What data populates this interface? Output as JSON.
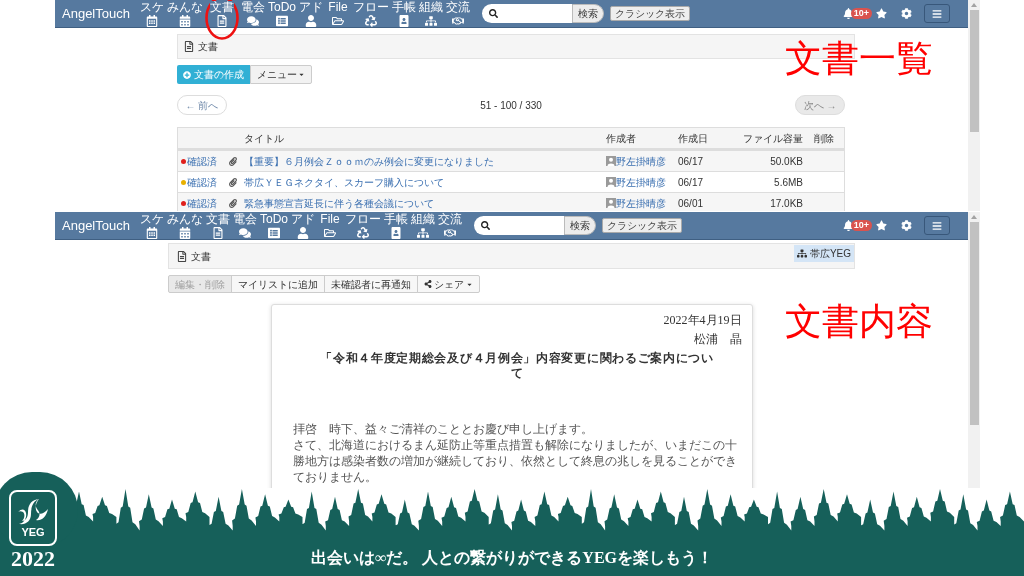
{
  "screenshots": [
    {
      "kind": "document_list",
      "annotation": "文書一覧",
      "navbar": {
        "brand": "AngelTouch",
        "items": [
          {
            "label": "スケ",
            "circled": false
          },
          {
            "label": "みんな",
            "circled": false
          },
          {
            "label": "文書",
            "circled": true
          },
          {
            "label": "電会",
            "circled": false
          },
          {
            "label": "ToDo",
            "circled": false
          },
          {
            "label": "アド",
            "circled": false
          },
          {
            "label": "File",
            "circled": false
          },
          {
            "label": "フロー",
            "circled": false
          },
          {
            "label": "手帳",
            "circled": false
          },
          {
            "label": "組織",
            "circled": false
          },
          {
            "label": "交流",
            "circled": false
          }
        ],
        "search_button": "検索",
        "classic_button": "クラシック表示",
        "notification_count": "10+"
      },
      "header": {
        "title": "文書"
      },
      "actions": {
        "create_button": "文書の作成",
        "menu_button": "メニュー"
      },
      "pager": {
        "previous": "← 前へ",
        "range": "51 - 100 / 330",
        "next": "次へ →"
      },
      "table": {
        "columns": [
          "タイトル",
          "作成者",
          "作成日",
          "ファイル容量",
          "削除"
        ],
        "rows": [
          {
            "status": "確認済",
            "color": "#e0201c",
            "title": "【重要】６月例会Ｚｏｏｍのみ例会に変更になりました",
            "author": "野左掛晴彦",
            "date": "06/17",
            "size": "50.0KB"
          },
          {
            "status": "確認済",
            "color": "#e8b000",
            "title": "帯広ＹＥＧネクタイ、スカーフ購入について",
            "author": "野左掛晴彦",
            "date": "06/17",
            "size": "5.6MB"
          },
          {
            "status": "確認済",
            "color": "#e0201c",
            "title": "緊急事態宣言延長に伴う各種会議について",
            "author": "野左掛晴彦",
            "date": "06/01",
            "size": "17.0KB"
          }
        ]
      }
    },
    {
      "kind": "document_view",
      "annotation": "文書内容",
      "navbar": {
        "brand": "AngelTouch",
        "items": [
          {
            "label": "スケ",
            "circled": false
          },
          {
            "label": "みんな",
            "circled": false
          },
          {
            "label": "文書",
            "circled": false
          },
          {
            "label": "電会",
            "circled": false
          },
          {
            "label": "ToDo",
            "circled": false
          },
          {
            "label": "アド",
            "circled": false
          },
          {
            "label": "File",
            "circled": false
          },
          {
            "label": "フロー",
            "circled": false
          },
          {
            "label": "手帳",
            "circled": false
          },
          {
            "label": "組織",
            "circled": false
          },
          {
            "label": "交流",
            "circled": false
          }
        ],
        "search_button": "検索",
        "classic_button": "クラシック表示",
        "notification_count": "10+"
      },
      "header": {
        "title": "文書",
        "group": "帯広YEG"
      },
      "toolbar": [
        {
          "label": "編集・削除",
          "kind": "button",
          "disabled": true
        },
        {
          "label": "マイリストに追加",
          "kind": "button",
          "disabled": false
        },
        {
          "label": "未確認者に再通知",
          "kind": "button",
          "disabled": false
        },
        {
          "label": "シェア",
          "kind": "share_menu",
          "disabled": false
        }
      ],
      "document": {
        "date": "2022年4月19日",
        "author": "松浦　晶",
        "title": "「令和４年度定期総会及び４月例会」内容変更に関わるご案内について",
        "paragraphs": [
          "拝啓　時下、益々ご清祥のこととお慶び申し上げます。",
          "さて、北海道におけるまん延防止等重点措置も解除になりましたが、いまだこの十勝地方は感染者数の増加が継続しており、依然として終息の兆しを見ることができておりません。"
        ]
      }
    }
  ],
  "banner": {
    "logo_text": "YEG",
    "year": "2022",
    "slogan": "出会いは∞だ。 人との繋がりができるYEGを楽しもう！"
  }
}
